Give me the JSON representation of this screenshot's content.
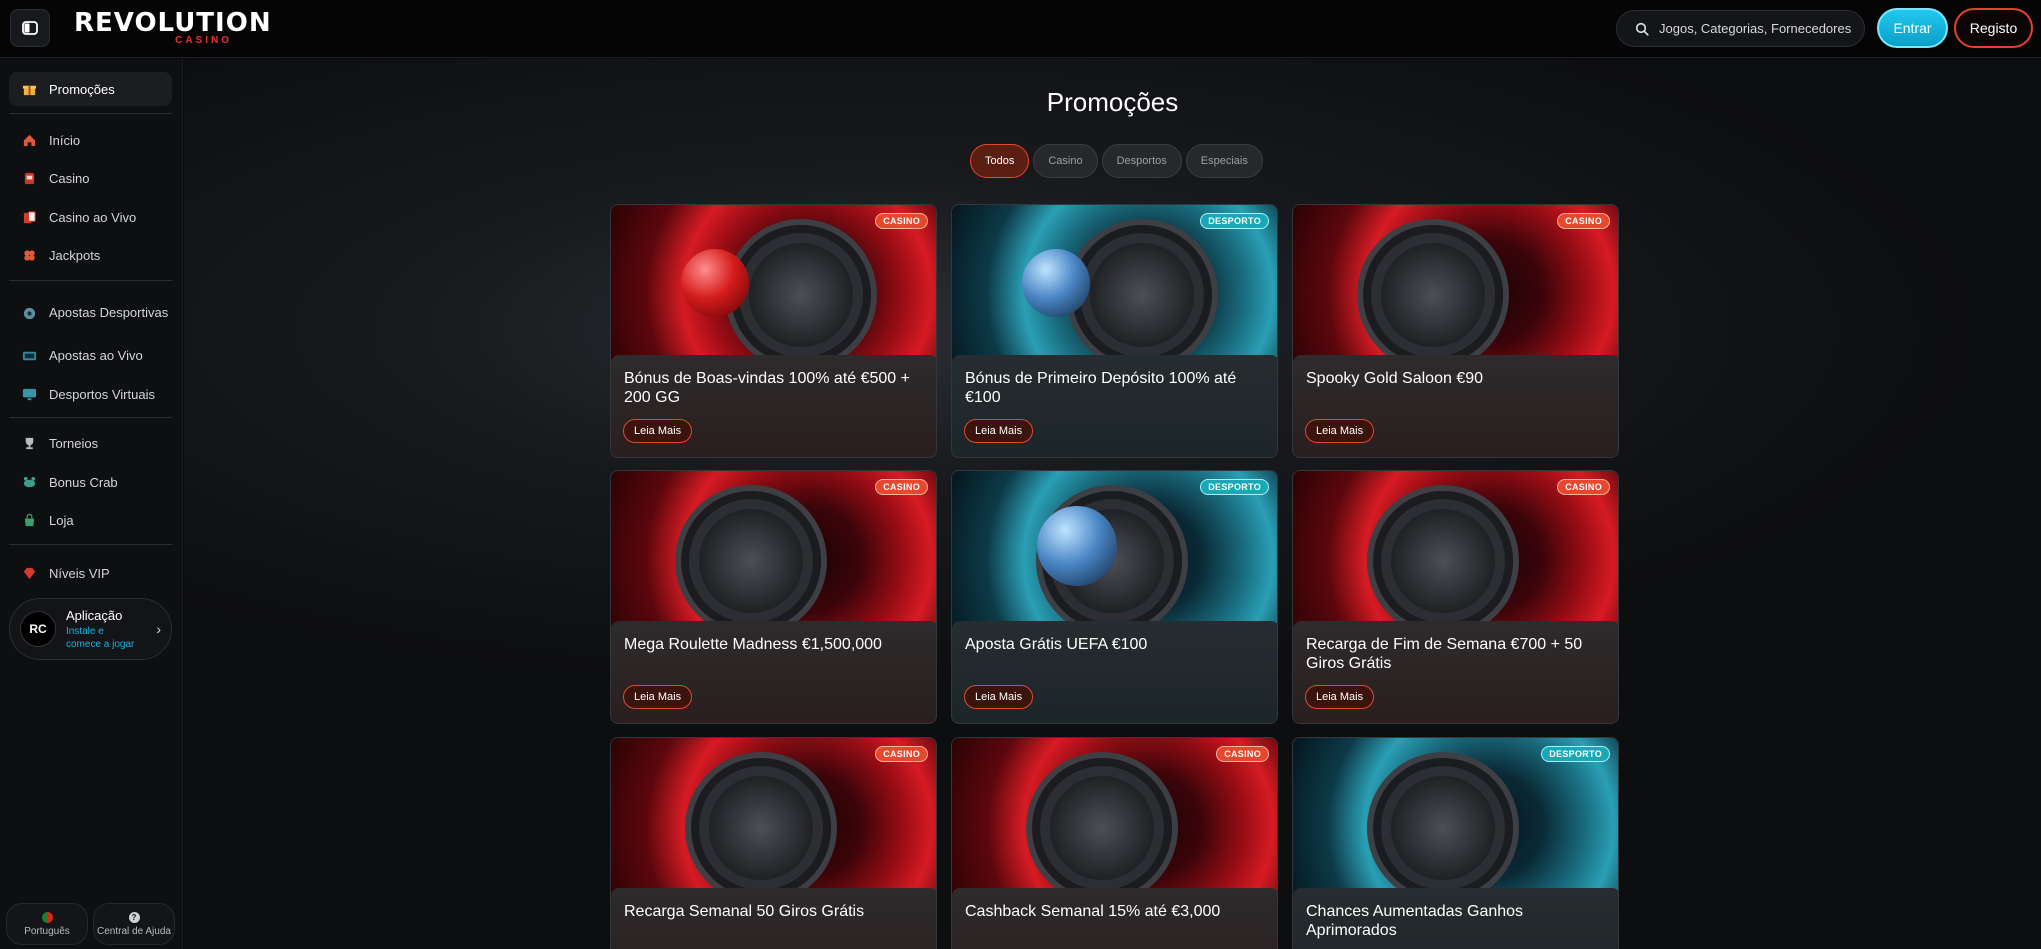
{
  "header": {
    "logo_main": "REVOLUTION",
    "logo_sub": "CASINO",
    "search_placeholder": "Jogos, Categorias, Fornecedores",
    "login_label": "Entrar",
    "register_label": "Registo"
  },
  "sidebar": {
    "items": [
      {
        "label": "Promoções",
        "icon": "gift-icon"
      },
      {
        "label": "Início",
        "icon": "home-icon"
      },
      {
        "label": "Casino",
        "icon": "slot-machine-icon"
      },
      {
        "label": "Casino ao Vivo",
        "icon": "cards-icon"
      },
      {
        "label": "Jackpots",
        "icon": "clover-icon"
      },
      {
        "label": "Apostas Desportivas",
        "icon": "football-icon"
      },
      {
        "label": "Apostas ao Vivo",
        "icon": "live-tv-icon"
      },
      {
        "label": "Desportos Virtuais",
        "icon": "monitor-icon"
      },
      {
        "label": "Torneios",
        "icon": "trophy-icon"
      },
      {
        "label": "Bonus Crab",
        "icon": "crab-icon"
      },
      {
        "label": "Loja",
        "icon": "shop-icon"
      },
      {
        "label": "Níveis VIP",
        "icon": "diamond-icon"
      }
    ],
    "app": {
      "logo": "RC",
      "title": "Aplicação",
      "subtitle_line1": "Instale e",
      "subtitle_line2": "comece a jogar"
    },
    "language_label": "Português",
    "help_label": "Central de Ajuda"
  },
  "main": {
    "title": "Promoções",
    "tabs": [
      "Todos",
      "Casino",
      "Desportos",
      "Especiais"
    ],
    "active_tab": "Todos",
    "read_more_label": "Leia Mais",
    "cards": [
      {
        "title": "Bónus de Boas-vindas 100% até €500 + 200 GG",
        "badge": "CASINO"
      },
      {
        "title": "Bónus de Primeiro Depósito 100% até €100",
        "badge": "DESPORTO"
      },
      {
        "title": "Spooky Gold Saloon €90",
        "badge": "CASINO"
      },
      {
        "title": "Mega Roulette Madness €1,500,000",
        "badge": "CASINO"
      },
      {
        "title": "Aposta Grátis UEFA €100",
        "badge": "DESPORTO"
      },
      {
        "title": "Recarga de Fim de Semana €700 + 50 Giros Grátis",
        "badge": "CASINO"
      },
      {
        "title": "Recarga Semanal 50 Giros Grátis",
        "badge": "CASINO"
      },
      {
        "title": "Cashback Semanal 15% até €3,000",
        "badge": "CASINO"
      },
      {
        "title": "Chances Aumentadas Ganhos Aprimorados",
        "badge": "DESPORTO"
      }
    ]
  },
  "colors": {
    "accent_red": "#e5482c",
    "accent_cyan": "#19a9b6",
    "login_blue": "#0fb3db"
  }
}
